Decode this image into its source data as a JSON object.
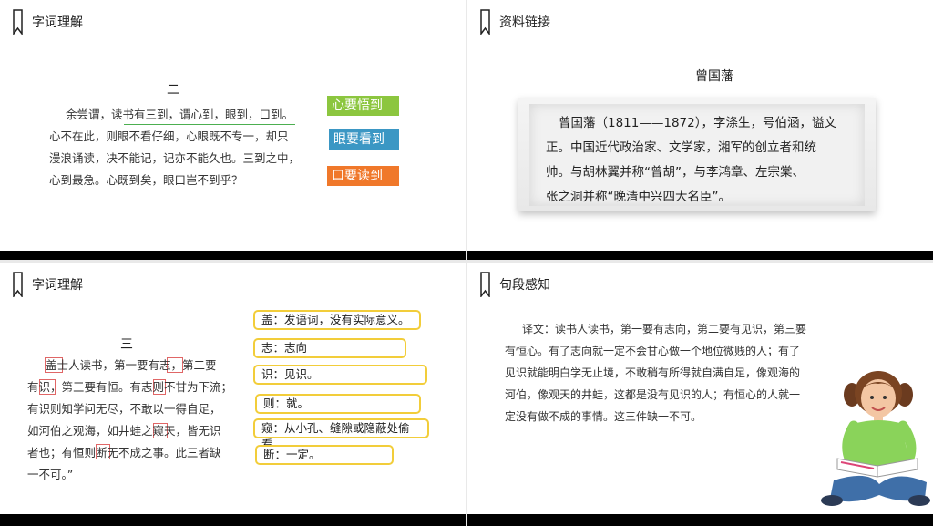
{
  "slide1": {
    "title": "字词理解",
    "number": "二",
    "lines": [
      "余尝谓，读书有三到，谓心到，眼到，口到。",
      "心不在此，则眼不看仔细，心眼既不专一，却只",
      "漫浪诵读，决不能记，记亦不能久也。三到之中，",
      "心到最急。心既到矣，眼口岂不到乎？"
    ],
    "tags": [
      {
        "label": "心要悟到",
        "color": "#8cc63f"
      },
      {
        "label": "眼要看到",
        "color": "#3b97c4"
      },
      {
        "label": "口要读到",
        "color": "#f0782a"
      }
    ]
  },
  "slide2": {
    "title": "资料链接",
    "name": "曾国藩",
    "lines": [
      "曾国藩（1811——1872），字涤生，号伯涵，谥文",
      "正。中国近代政治家、文学家，湘军的创立者和统",
      "帅。与胡林翼并称“曾胡”，与李鸿章、左宗棠、",
      "张之洞并称“晚清中兴四大名臣”。"
    ]
  },
  "slide3": {
    "title": "字词理解",
    "number": "三",
    "lines": [
      "盖士人读书，第一要有志，第二要",
      "有识，第三要有恒。有志则不甘为下流；",
      "有识则知学问无尽，不敢以一得自足，",
      "如河伯之观海，如井蛙之窥天，皆无识",
      "者也；有恒则断无不成之事。此三者缺",
      "一不可。”"
    ],
    "notes": [
      "盖：发语词，没有实际意义。",
      "志：志向",
      "识：见识。",
      "则：就。",
      "窥：从小孔、缝隙或隐蔽处偷看。",
      "断：一定。"
    ]
  },
  "slide4": {
    "title": "句段感知",
    "lines": [
      "译文：读书人读书，第一要有志向，第二要有见识，第三要",
      "有恒心。有了志向就一定不会甘心做一个地位微贱的人；有了",
      "见识就能明白学无止境，不敢稍有所得就自满自足，像观海的",
      "河伯，像观天的井蛙，这都是没有见识的人；有恒心的人就一",
      "定没有做不成的事情。这三件缺一不可。"
    ]
  }
}
